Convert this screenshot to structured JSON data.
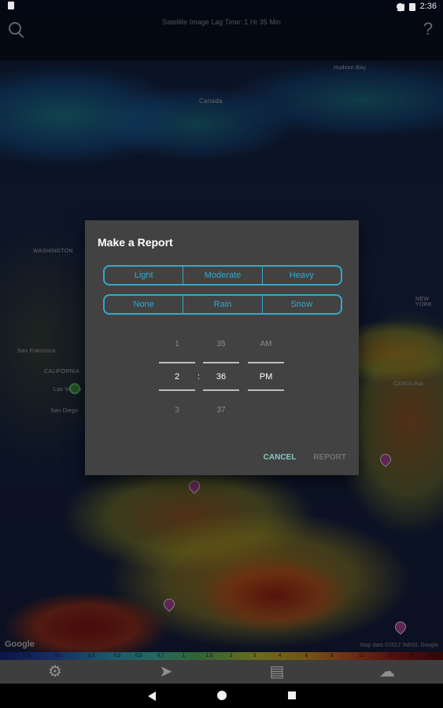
{
  "status_bar": {
    "time": "2:36"
  },
  "map": {
    "lag_text": "Satellite Image Lag Time: 1 Hr 35 Min",
    "labels": {
      "canada": "Canada",
      "hudson_bay": "Hudson Bay",
      "washington": "WASHINGTON",
      "san_francisco": "San Francisco",
      "california": "CALIFORNIA",
      "las_vegas": "Las Vegas",
      "san_diego": "San Diego",
      "carolina": "CAROLINA",
      "new_york": "NEW YORK"
    },
    "google_logo": "Google",
    "attribution": "Map data ©2017 INEGI, Google"
  },
  "scale": {
    "values": [
      "in",
      "0.03",
      "0.1",
      "0.2",
      "0.3",
      "0.5",
      "0.7",
      "1",
      "1.5",
      "2",
      "3",
      "4",
      "6",
      "8",
      "12",
      "20",
      "30",
      "40"
    ]
  },
  "dialog": {
    "title": "Make a Report",
    "intensity_options": [
      "Light",
      "Moderate",
      "Heavy"
    ],
    "type_options": [
      "None",
      "Rain",
      "Snow"
    ],
    "hour": {
      "prev": "1",
      "selected": "2",
      "next": "3"
    },
    "minute": {
      "prev": "35",
      "selected": "36",
      "next": "37"
    },
    "ampm": {
      "prev": "AM",
      "selected": "PM"
    },
    "separator": ":",
    "cancel_label": "CANCEL",
    "report_label": "REPORT"
  },
  "colors": {
    "accent": "#35a8c8",
    "cancel": "#80cbc4",
    "dialog_bg": "#424242"
  }
}
